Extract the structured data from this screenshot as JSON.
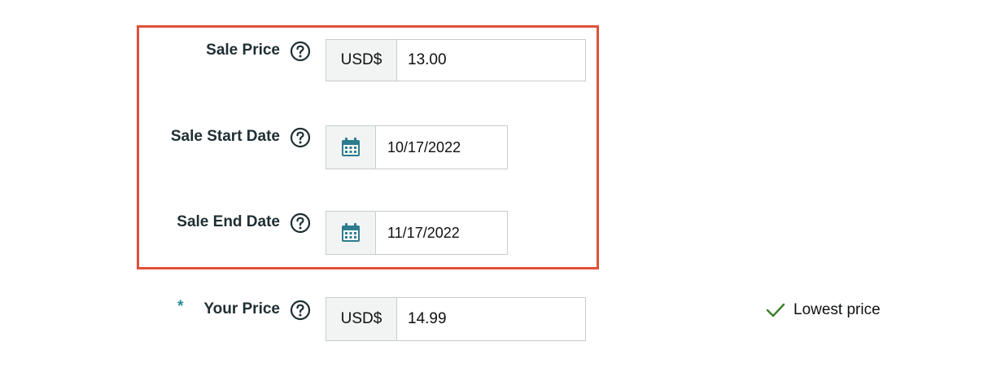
{
  "sale_price": {
    "label": "Sale Price",
    "currency": "USD$",
    "value": "13.00"
  },
  "sale_start_date": {
    "label": "Sale Start Date",
    "value": "10/17/2022",
    "icon": "calendar-icon"
  },
  "sale_end_date": {
    "label": "Sale End Date",
    "value": "11/17/2022",
    "icon": "calendar-icon"
  },
  "your_price": {
    "required_marker": "*",
    "label": "Your Price",
    "currency": "USD$",
    "value": "14.99"
  },
  "price_status": {
    "text": "Lowest price",
    "icon": "checkmark-icon"
  },
  "colors": {
    "highlight_border": "#e0513b",
    "calendar_icon": "#2d7c8e",
    "checkmark": "#3a7d2a",
    "label_text": "#1f2e33"
  }
}
